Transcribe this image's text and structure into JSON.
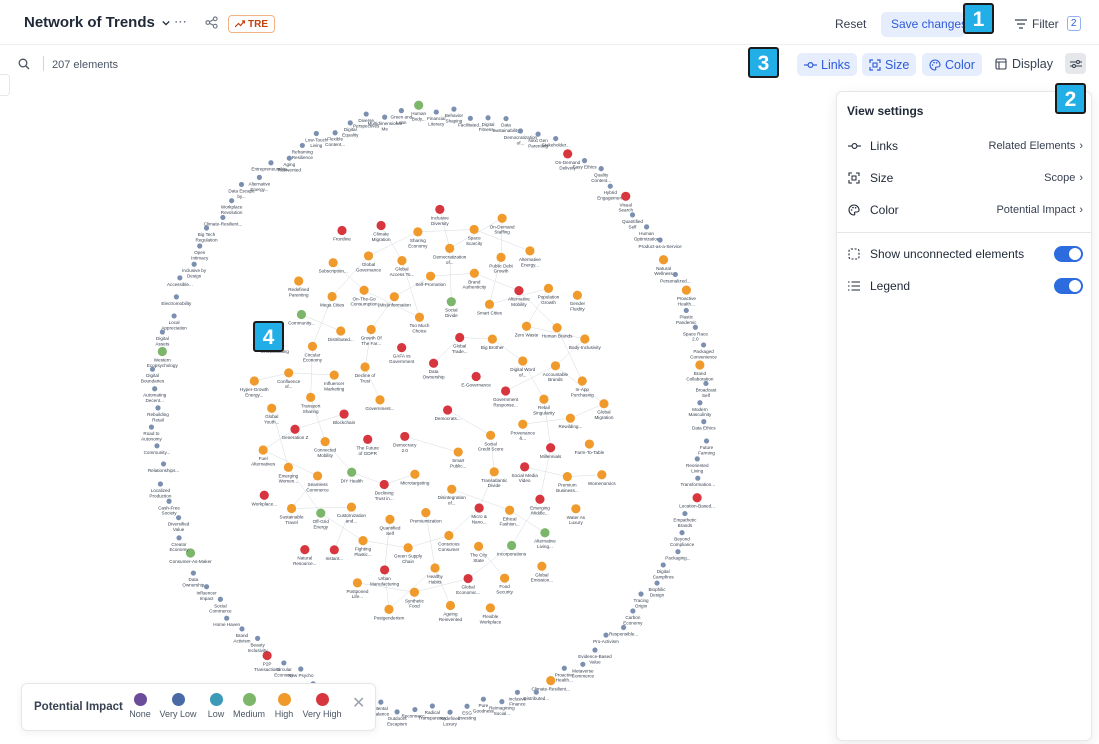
{
  "header": {
    "title": "Network of Trends",
    "badge": "TRE",
    "reset_label": "Reset",
    "save_label": "Save changes",
    "filter_label": "Filter",
    "filter_count": "2"
  },
  "markers": [
    "1",
    "2",
    "3",
    "4"
  ],
  "toolbar": {
    "element_count": "207 elements",
    "links_label": "Links",
    "size_label": "Size",
    "color_label": "Color",
    "display_label": "Display"
  },
  "view_settings": {
    "title": "View settings",
    "rows": [
      {
        "label": "Links",
        "value": "Related Elements",
        "icon": "links-icon"
      },
      {
        "label": "Size",
        "value": "Scope",
        "icon": "size-icon"
      },
      {
        "label": "Color",
        "value": "Potential Impact",
        "icon": "palette-icon"
      }
    ],
    "toggles": [
      {
        "label": "Show unconnected elements",
        "on": true,
        "icon": "unconnected-icon"
      },
      {
        "label": "Legend",
        "on": true,
        "icon": "legend-icon"
      }
    ]
  },
  "legend": {
    "title": "Potential Impact",
    "items": [
      {
        "label": "None",
        "color": "#6b4c9a"
      },
      {
        "label": "Very Low",
        "color": "#4a6aa5"
      },
      {
        "label": "Low",
        "color": "#3b9ab8"
      },
      {
        "label": "Medium",
        "color": "#7cb66a"
      },
      {
        "label": "High",
        "color": "#ef9a2b"
      },
      {
        "label": "Very High",
        "color": "#d8363f"
      }
    ]
  },
  "colors": {
    "very_low": "#7b8fb0",
    "medium": "#7cb66a",
    "high": "#ef9a2b",
    "very_high": "#d8363f",
    "accent": "#2d5bd7"
  },
  "graph": {
    "nodes": [
      {
        "label": "Facilitated...",
        "impact": "very_low"
      },
      {
        "label": "Digital Fitness...",
        "impact": "very_low"
      },
      {
        "label": "Data Sustainability",
        "impact": "very_low"
      },
      {
        "label": "Democratization of...",
        "impact": "very_low"
      },
      {
        "label": "Next Gen Parenting",
        "impact": "very_low"
      },
      {
        "label": "Stakeholder...",
        "impact": "very_low"
      },
      {
        "label": "On-Demand Delivery",
        "impact": "very_high"
      },
      {
        "label": "Easy Ethics",
        "impact": "very_low"
      },
      {
        "label": "Quality Content...",
        "impact": "very_low"
      },
      {
        "label": "Hybrid Engagement",
        "impact": "very_low"
      },
      {
        "label": "Visual Search",
        "impact": "very_high"
      },
      {
        "label": "Quantified Self",
        "impact": "very_low"
      },
      {
        "label": "Human Optimization",
        "impact": "very_low"
      },
      {
        "label": "Product-as-a-Service",
        "impact": "very_low"
      },
      {
        "label": "Natural Wellness",
        "impact": "high"
      },
      {
        "label": "Personalized...",
        "impact": "very_low"
      },
      {
        "label": "Proactive Health...",
        "impact": "high"
      },
      {
        "label": "Plastic Pandemic",
        "impact": "very_low"
      },
      {
        "label": "Space Race 2.0",
        "impact": "very_low"
      },
      {
        "label": "Packaged Convenience",
        "impact": "very_low"
      },
      {
        "label": "Brand Collaboration",
        "impact": "high"
      },
      {
        "label": "Broadcast Self",
        "impact": "very_low"
      },
      {
        "label": "Modern Masculinity",
        "impact": "very_low"
      },
      {
        "label": "Data Ethics",
        "impact": "very_low"
      },
      {
        "label": "Future Farming",
        "impact": "very_low"
      },
      {
        "label": "Reoriented Living",
        "impact": "very_low"
      },
      {
        "label": "Transformation...",
        "impact": "very_low"
      },
      {
        "label": "Location-Based...",
        "impact": "very_high"
      },
      {
        "label": "Empathetic Brands",
        "impact": "very_low"
      },
      {
        "label": "Beyond Compliance",
        "impact": "very_low"
      },
      {
        "label": "Packaging...",
        "impact": "very_low"
      },
      {
        "label": "Digital Campfires",
        "impact": "very_low"
      },
      {
        "label": "Biophilic Design",
        "impact": "very_low"
      },
      {
        "label": "Tracing Origin",
        "impact": "very_low"
      },
      {
        "label": "Carbon Economy",
        "impact": "very_low"
      },
      {
        "label": "Responsible...",
        "impact": "very_low"
      },
      {
        "label": "Pro-Activism",
        "impact": "very_low"
      },
      {
        "label": "Evidence-Based Value",
        "impact": "very_low"
      },
      {
        "label": "Metaverse Commerce",
        "impact": "very_low"
      },
      {
        "label": "Proactive Health...",
        "impact": "very_low"
      },
      {
        "label": "Climate-Resilient...",
        "impact": "high"
      },
      {
        "label": "Distributed...",
        "impact": "very_low"
      },
      {
        "label": "Inclusive Finance",
        "impact": "very_low"
      },
      {
        "label": "Reimagining Social...",
        "impact": "very_low"
      },
      {
        "label": "Pure Goodness",
        "impact": "very_low"
      },
      {
        "label": "ESG Investing",
        "impact": "very_low"
      },
      {
        "label": "Redefined Luxury",
        "impact": "very_low"
      },
      {
        "label": "Radical Transparency",
        "impact": "very_low"
      },
      {
        "label": "Reconnecc...",
        "impact": "very_low"
      },
      {
        "label": "Outdoors Escapism",
        "impact": "very_low"
      },
      {
        "label": "Mental Balance",
        "impact": "very_low"
      },
      {
        "label": "Identity Pluralism",
        "impact": "high"
      },
      {
        "label": "Bioengineering",
        "impact": "very_low"
      },
      {
        "label": "Mobility Ecosystems",
        "impact": "very_low"
      },
      {
        "label": "Value-Driven...",
        "impact": "very_low"
      },
      {
        "label": "New Psycho",
        "impact": "very_low"
      },
      {
        "label": "Circular Economy",
        "impact": "very_low"
      },
      {
        "label": "P2P Transactions",
        "impact": "very_high"
      },
      {
        "label": "Beauty Inclusivity",
        "impact": "very_low"
      },
      {
        "label": "Brand Activism",
        "impact": "very_low"
      },
      {
        "label": "Home Haven",
        "impact": "very_low"
      },
      {
        "label": "Social Commerce",
        "impact": "very_low"
      },
      {
        "label": "Influencer Impact",
        "impact": "very_low"
      },
      {
        "label": "Data Ownership",
        "impact": "very_low"
      },
      {
        "label": "Consumer-As-Maker",
        "impact": "medium"
      },
      {
        "label": "Creator Economy",
        "impact": "very_low"
      },
      {
        "label": "Diversified Value",
        "impact": "very_low"
      },
      {
        "label": "Cash-Free Society",
        "impact": "very_low"
      },
      {
        "label": "Localized Production",
        "impact": "very_low"
      },
      {
        "label": "Relationships...",
        "impact": "very_low"
      },
      {
        "label": "Community...",
        "impact": "very_low"
      },
      {
        "label": "Road to Autonomy",
        "impact": "very_low"
      },
      {
        "label": "Rebuilding Retail",
        "impact": "very_low"
      },
      {
        "label": "Automating Decent...",
        "impact": "very_low"
      },
      {
        "label": "Digital Boundaries",
        "impact": "very_low"
      },
      {
        "label": "Western Ecopsychology",
        "impact": "medium"
      },
      {
        "label": "Digital Assets",
        "impact": "very_low"
      },
      {
        "label": "Local Appreciation",
        "impact": "very_low"
      },
      {
        "label": "Electromobility",
        "impact": "very_low"
      },
      {
        "label": "Accessible...",
        "impact": "very_low"
      },
      {
        "label": "Inclusive by Design",
        "impact": "very_low"
      },
      {
        "label": "Open Intimacy",
        "impact": "very_low"
      },
      {
        "label": "Big Tech Regulation",
        "impact": "very_low"
      },
      {
        "label": "Climate-Resilient...",
        "impact": "very_low"
      },
      {
        "label": "Workplace Revolution",
        "impact": "very_low"
      },
      {
        "label": "Data Escape by...",
        "impact": "very_low"
      },
      {
        "label": "Alternative Energy...",
        "impact": "very_low"
      },
      {
        "label": "Entrepreneurship...",
        "impact": "very_low"
      },
      {
        "label": "Aging Reinvented",
        "impact": "very_low"
      },
      {
        "label": "Reframing Resilience",
        "impact": "very_low"
      },
      {
        "label": "Low-Touch Living",
        "impact": "very_low"
      },
      {
        "label": "Flexible Content...",
        "impact": "very_low"
      },
      {
        "label": "Digital Equality",
        "impact": "very_low"
      },
      {
        "label": "Diverse Perspectives",
        "impact": "very_low"
      },
      {
        "label": "Multidimensional Me",
        "impact": "very_low"
      },
      {
        "label": "Green and Lean",
        "impact": "very_low"
      },
      {
        "label": "Human Body...",
        "impact": "medium"
      },
      {
        "label": "Financial Literacy",
        "impact": "very_low"
      },
      {
        "label": "Behavior Shaping",
        "impact": "very_low"
      },
      {
        "label": "Democrats...",
        "impact": "very_high"
      },
      {
        "label": "Democracy 2.0",
        "impact": "very_high"
      },
      {
        "label": "Data Ownership",
        "impact": "very_high"
      },
      {
        "label": "Smart Public...",
        "impact": "high"
      },
      {
        "label": "Government...",
        "impact": "high"
      },
      {
        "label": "E-Governance",
        "impact": "very_high"
      },
      {
        "label": "Microtargeting",
        "impact": "high"
      },
      {
        "label": "GAFA vs Government",
        "impact": "very_high"
      },
      {
        "label": "Social Credit Score",
        "impact": "high"
      },
      {
        "label": "The Future of GDPR",
        "impact": "very_high"
      },
      {
        "label": "Global Trade...",
        "impact": "very_high"
      },
      {
        "label": "Disintegration of...",
        "impact": "high"
      },
      {
        "label": "Decline of Trust",
        "impact": "high"
      },
      {
        "label": "Government Response...",
        "impact": "very_high"
      },
      {
        "label": "Declining Trust in...",
        "impact": "very_high"
      },
      {
        "label": "Too Much Choice",
        "impact": "high"
      },
      {
        "label": "Transatlantic Divide",
        "impact": "high"
      },
      {
        "label": "Blockchain",
        "impact": "very_high"
      },
      {
        "label": "Big Brother",
        "impact": "high"
      },
      {
        "label": "Premiumization",
        "impact": "high"
      },
      {
        "label": "Growth Of The Far...",
        "impact": "high"
      },
      {
        "label": "Provenance &...",
        "impact": "high"
      },
      {
        "label": "DIY Health",
        "impact": "medium"
      },
      {
        "label": "Social Divide",
        "impact": "medium"
      },
      {
        "label": "Micro & Nano...",
        "impact": "very_high"
      },
      {
        "label": "Influencer Marketing",
        "impact": "high"
      },
      {
        "label": "Digital Word of...",
        "impact": "high"
      },
      {
        "label": "Quantified Self",
        "impact": "high"
      },
      {
        "label": "(Mis)information",
        "impact": "high"
      },
      {
        "label": "Social Media Video",
        "impact": "very_high"
      },
      {
        "label": "Connected Mobility",
        "impact": "high"
      },
      {
        "label": "Smart Cities",
        "impact": "high"
      },
      {
        "label": "Conscious Consumer",
        "impact": "high"
      },
      {
        "label": "Distributed...",
        "impact": "high"
      },
      {
        "label": "Retail Singularity",
        "impact": "high"
      },
      {
        "label": "Customization and...",
        "impact": "high"
      },
      {
        "label": "Self-Promotion",
        "impact": "high"
      },
      {
        "label": "Ethical Fashion...",
        "impact": "high"
      },
      {
        "label": "Transport Sharing",
        "impact": "high"
      },
      {
        "label": "Zero Waste",
        "impact": "high"
      },
      {
        "label": "Green Supply Chain",
        "impact": "high"
      },
      {
        "label": "On-The-Go Consumption",
        "impact": "high"
      },
      {
        "label": "Millennials",
        "impact": "very_high"
      },
      {
        "label": "Seamless Commerce",
        "impact": "high"
      },
      {
        "label": "Brand Authenticity",
        "impact": "high"
      },
      {
        "label": "The City State",
        "impact": "high"
      },
      {
        "label": "Circular Economy",
        "impact": "high"
      },
      {
        "label": "Accountable Brands",
        "impact": "high"
      },
      {
        "label": "Fighting Plastic...",
        "impact": "high"
      },
      {
        "label": "Global Access To...",
        "impact": "high"
      },
      {
        "label": "Emerging Middle...",
        "impact": "very_high"
      },
      {
        "label": "Generation Z",
        "impact": "very_high"
      },
      {
        "label": "Alternative Mobility",
        "impact": "very_high"
      },
      {
        "label": "Healthy Habits",
        "impact": "high"
      },
      {
        "label": "Mega Cities",
        "impact": "high"
      },
      {
        "label": "Rewilding...",
        "impact": "high"
      },
      {
        "label": "Off-Grid Energy",
        "impact": "medium"
      },
      {
        "label": "Democratization of...",
        "impact": "high"
      },
      {
        "label": "Incorporations",
        "impact": "medium"
      },
      {
        "label": "Confluence of...",
        "impact": "high"
      },
      {
        "label": "Human Brands",
        "impact": "high"
      },
      {
        "label": "Urban Manufacturing",
        "impact": "very_high"
      },
      {
        "label": "Global Governance",
        "impact": "high"
      },
      {
        "label": "Premium Business...",
        "impact": "high"
      },
      {
        "label": "Emerging Women...",
        "impact": "high"
      },
      {
        "label": "Public Debt Growth",
        "impact": "high"
      },
      {
        "label": "Global Economic...",
        "impact": "very_high"
      },
      {
        "label": "Community...",
        "impact": "medium"
      },
      {
        "label": "In-App Purchasing",
        "impact": "high"
      },
      {
        "label": "Instant...",
        "impact": "very_high"
      },
      {
        "label": "Sharing Economy",
        "impact": "high"
      },
      {
        "label": "Alternative Living...",
        "impact": "medium"
      },
      {
        "label": "Global Youth...",
        "impact": "high"
      },
      {
        "label": "Population Growth",
        "impact": "high"
      },
      {
        "label": "Synthetic Food",
        "impact": "high"
      },
      {
        "label": "Subscription...",
        "impact": "high"
      },
      {
        "label": "Farm-To-Table",
        "impact": "high"
      },
      {
        "label": "Sustainable Travel",
        "impact": "high"
      },
      {
        "label": "Space Scarcity",
        "impact": "high"
      },
      {
        "label": "Food Security",
        "impact": "high"
      },
      {
        "label": "Crowdfunding",
        "impact": "high"
      },
      {
        "label": "Body-Inclusivity",
        "impact": "high"
      },
      {
        "label": "Postponed Life...",
        "impact": "high"
      },
      {
        "label": "Climate Migration",
        "impact": "very_high"
      },
      {
        "label": "Water As Luxury",
        "impact": "high"
      },
      {
        "label": "Fuel Alternatives",
        "impact": "high"
      },
      {
        "label": "Alternative Energy...",
        "impact": "high"
      },
      {
        "label": "Ageing Reinvented",
        "impact": "high"
      },
      {
        "label": "Redefined Parenting",
        "impact": "high"
      },
      {
        "label": "Global Migration",
        "impact": "high"
      },
      {
        "label": "Natural Resource...",
        "impact": "very_high"
      },
      {
        "label": "Inclusive Diversity",
        "impact": "very_high"
      },
      {
        "label": "Global Emission...",
        "impact": "high"
      },
      {
        "label": "Hyper-Growth Energy...",
        "impact": "high"
      },
      {
        "label": "Gender Fluidity",
        "impact": "high"
      },
      {
        "label": "Postgenderism",
        "impact": "high"
      },
      {
        "label": "Frontline",
        "impact": "very_high"
      },
      {
        "label": "Womenomics",
        "impact": "high"
      },
      {
        "label": "Workplace...",
        "impact": "very_high"
      },
      {
        "label": "On-Demand Staffing",
        "impact": "high"
      },
      {
        "label": "Flexible Workplace",
        "impact": "high"
      }
    ]
  }
}
